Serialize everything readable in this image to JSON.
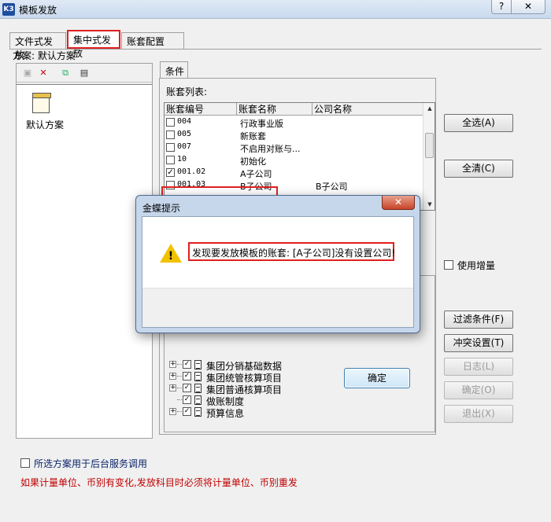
{
  "window": {
    "title": "模板发放",
    "help_label": "?",
    "close_label": "✕",
    "logo_text": "K3"
  },
  "tabs": {
    "file": "文件式发放",
    "central": "集中式发放",
    "account": "账套配置"
  },
  "scheme": {
    "label": "方案: 默认方案",
    "item_label": "默认方案"
  },
  "conditions": {
    "tab_label": "条件",
    "account_list_title": "账套列表:",
    "columns": [
      "账套编号",
      "账套名称",
      "公司名称"
    ],
    "rows": [
      {
        "checked": false,
        "code": "004",
        "name": "行政事业版",
        "company": ""
      },
      {
        "checked": false,
        "code": "005",
        "name": "新账套",
        "company": ""
      },
      {
        "checked": false,
        "code": "007",
        "name": "不启用对账与...",
        "company": ""
      },
      {
        "checked": false,
        "code": "10",
        "name": "初始化",
        "company": ""
      },
      {
        "checked": true,
        "code": "001.02",
        "name": "A子公司",
        "company": ""
      },
      {
        "checked": false,
        "code": "001.03",
        "name": "B子公司",
        "company": "B子公司"
      }
    ],
    "tree_items": [
      {
        "label": "集团分销基础数据",
        "expandable": true
      },
      {
        "label": "集团统管核算项目",
        "expandable": true
      },
      {
        "label": "集团普通核算项目",
        "expandable": true
      },
      {
        "label": "做账制度",
        "expandable": false
      },
      {
        "label": "预算信息",
        "expandable": true
      }
    ]
  },
  "buttons": {
    "select_all": "全选(A)",
    "clear_all": "全清(C)",
    "filter": "过滤条件(F)",
    "conflict": "冲突设置(T)",
    "log": "日志(L)",
    "ok": "确定(O)",
    "exit": "退出(X)"
  },
  "options": {
    "use_incremental": "使用增量",
    "background_service": "所选方案用于后台服务调用"
  },
  "warning_note": "如果计量单位、币别有变化,发放科目时必须将计量单位、币别重发",
  "dialog": {
    "title": "金蝶提示",
    "close_label": "✕",
    "message": "发现要发放模板的账套: [A子公司]没有设置公司!",
    "ok_label": "确定"
  },
  "colors": {
    "highlight": "#e02020",
    "warning_text": "#c00000",
    "link_text": "#0a246a"
  }
}
